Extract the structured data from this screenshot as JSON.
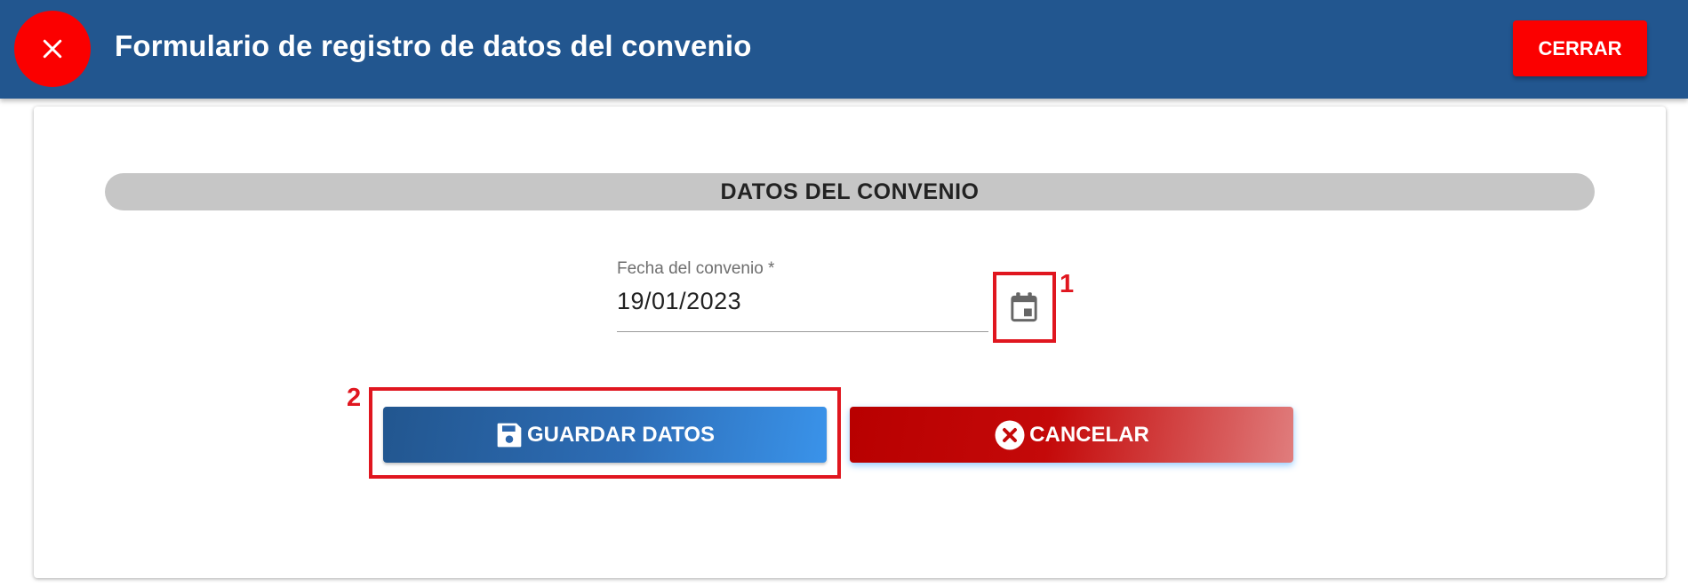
{
  "header": {
    "title": "Formulario de registro de datos del convenio",
    "close_button": "CERRAR",
    "close_icon": "close-icon"
  },
  "form": {
    "section_title": "DATOS DEL CONVENIO",
    "date_field": {
      "label": "Fecha del convenio *",
      "value": "19/01/2023",
      "icon": "calendar-icon"
    },
    "save_button": {
      "label": "GUARDAR DATOS",
      "icon": "floppy-disk-icon"
    },
    "cancel_button": {
      "label": "CANCELAR",
      "icon": "cancel-circle-icon"
    }
  },
  "annotations": {
    "marker_1": "1",
    "marker_2": "2"
  },
  "colors": {
    "header_bg": "#22568f",
    "accent_red": "#fb0000",
    "annotation_red": "#e0161f"
  }
}
